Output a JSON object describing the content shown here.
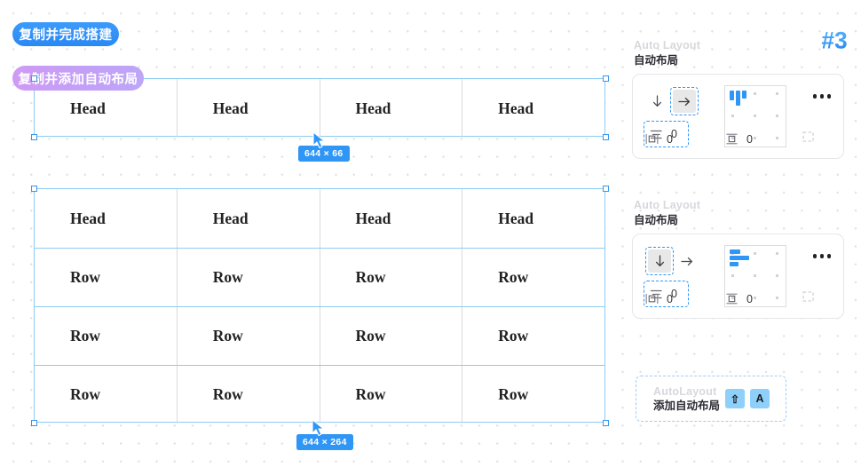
{
  "canvas": {
    "badges": [
      {
        "id": "copy-build",
        "label": "复制并完成搭建"
      },
      {
        "id": "copy-autolayout",
        "label": "复制并添加自动布局"
      }
    ],
    "step_badge": "#3",
    "tables": [
      {
        "id": "table-head-only",
        "dimension_label": "644 × 66",
        "rows": [
          {
            "type": "head",
            "cells": [
              "Head",
              "Head",
              "Head",
              "Head"
            ]
          }
        ]
      },
      {
        "id": "table-full",
        "dimension_label": "644 × 264",
        "rows": [
          {
            "type": "head",
            "cells": [
              "Head",
              "Head",
              "Head",
              "Head"
            ]
          },
          {
            "type": "row",
            "cells": [
              "Row",
              "Row",
              "Row",
              "Row"
            ]
          },
          {
            "type": "row",
            "cells": [
              "Row",
              "Row",
              "Row",
              "Row"
            ]
          },
          {
            "type": "row",
            "cells": [
              "Row",
              "Row",
              "Row",
              "Row"
            ]
          }
        ]
      }
    ]
  },
  "inspector": {
    "sections": [
      {
        "id": "auto-layout-horizontal",
        "ghost_title": "Auto Layout",
        "title": "自动布局",
        "direction": {
          "vertical_icon": "arrow-down-icon",
          "horizontal_icon": "arrow-right-icon",
          "selected": "horizontal"
        },
        "gap": {
          "icon": "gap-spacing-icon",
          "value": "0"
        },
        "alignment": {
          "preview": "bars-vertical",
          "position": "top-left"
        },
        "padding_horizontal": {
          "icon": "padding-horizontal-icon",
          "value": "0"
        },
        "padding_vertical": {
          "icon": "padding-vertical-icon",
          "value": "0"
        },
        "clip_content": {
          "icon": "clip-content-icon"
        },
        "more": {
          "icon": "more-horizontal-icon"
        }
      },
      {
        "id": "auto-layout-vertical",
        "ghost_title": "Auto Layout",
        "title": "自动布局",
        "direction": {
          "vertical_icon": "arrow-down-icon",
          "horizontal_icon": "arrow-right-icon",
          "selected": "vertical"
        },
        "gap": {
          "icon": "gap-spacing-icon",
          "value": "0"
        },
        "alignment": {
          "preview": "bars-horizontal",
          "position": "top-left"
        },
        "padding_horizontal": {
          "icon": "padding-horizontal-icon",
          "value": "0"
        },
        "padding_vertical": {
          "icon": "padding-vertical-icon",
          "value": "0"
        },
        "clip_content": {
          "icon": "clip-content-icon"
        },
        "more": {
          "icon": "more-horizontal-icon"
        }
      }
    ],
    "add_auto_layout": {
      "ghost_title": "AutoLayout",
      "title": "添加自动布局",
      "shortcut_keys": [
        "⇧",
        "A"
      ]
    }
  },
  "colors": {
    "accent_blue": "#2f96f6",
    "table_border": "#8ccdf2",
    "pill_purple": "#c2a0f7",
    "key_blue": "#8ed0fa"
  }
}
